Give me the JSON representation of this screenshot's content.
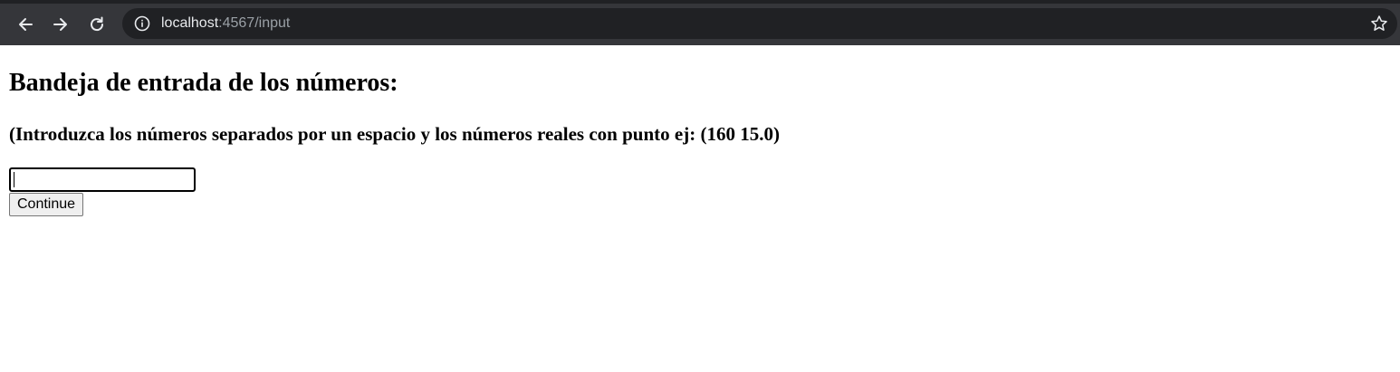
{
  "browser": {
    "url_host": "localhost",
    "url_rest": ":4567/input",
    "colors": {
      "toolbar": "#35363a",
      "omnibox": "#202124",
      "icon": "#e8eaed"
    },
    "icons": [
      "back-arrow-icon",
      "forward-arrow-icon",
      "reload-icon",
      "info-icon",
      "star-icon"
    ]
  },
  "page": {
    "title": "Bandeja de entrada de los números:",
    "subtitle": "(Introduzca los números separados por un espacio y los números reales con punto ej: (160 15.0)",
    "input": {
      "value": "",
      "placeholder": ""
    },
    "continue_label": "Continue"
  }
}
